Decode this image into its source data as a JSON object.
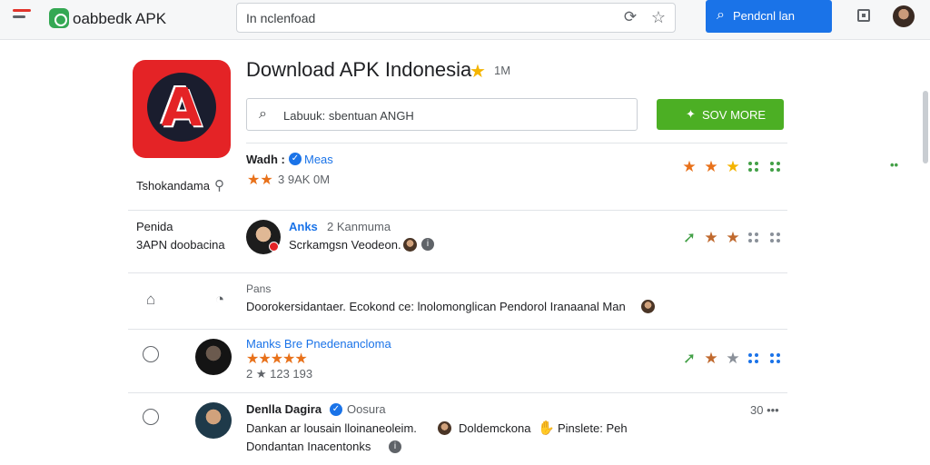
{
  "topbar": {
    "brand_title": "oabbedk APK",
    "url": "In nclenfoad",
    "search_button": "Pendcnl lan"
  },
  "app": {
    "title": "Download APK Indonesia",
    "title_meta": "1M",
    "search_text": "Labuuk: sbentuan ANGH",
    "action_button": "SOV MORE",
    "developer_label": "Tshokandama"
  },
  "rows": [
    {
      "title": "Wadh :",
      "title_link": "Meas",
      "subtitle": "3 9AK 0M",
      "ratings": [
        "star-orange",
        "star-orange",
        "star-yellow",
        "dots-green",
        "dots-green"
      ]
    },
    {
      "left_label_1": "Penida",
      "left_label_2": "3APN doobacina",
      "title": "Anks",
      "title_extra": "2 Kanmuma",
      "subtitle": "Scrkamgsn Veodeon.",
      "ratings": [
        "arrow-green",
        "star-brown",
        "star-brown",
        "dots-gray",
        "dots-gray"
      ]
    },
    {
      "label": "Pans",
      "text": "Doorokersidantaer. Ecokond ce: lnolomonglican Pendorol Iranaanal Man"
    },
    {
      "title": "Manks Bre Pnedenancloma",
      "subtitle": "2 ★ 123 193",
      "ratings": [
        "arrow-green",
        "star-brown",
        "star-gray",
        "dots-blue",
        "dots-blue"
      ]
    },
    {
      "title": "Denlla Dagira",
      "title_extra": "Oosura",
      "meta": "30 •••",
      "line1_a": "Dankan ar lousain lloinaneoleim.",
      "line1_b": "Doldemckona",
      "line1_c": "Pinslete: Peh",
      "line2": "Dondantan Inacentonks"
    }
  ],
  "colors": {
    "brand_blue": "#1a73e8",
    "brand_green": "#4caf24",
    "app_red": "#e42326",
    "star_yellow": "#f4b400",
    "star_orange": "#e8711a"
  }
}
